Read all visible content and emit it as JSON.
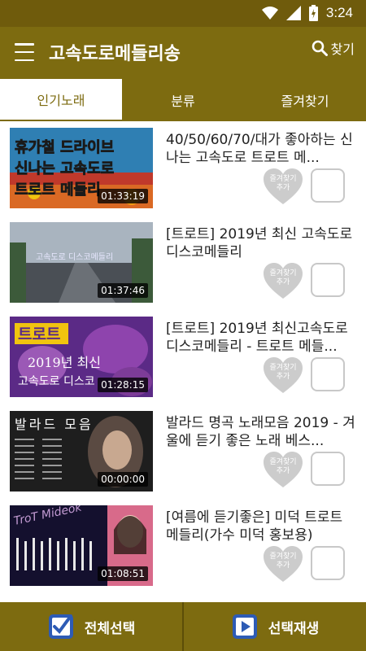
{
  "status_bar": {
    "time": "3:24",
    "icons": [
      "wifi-icon",
      "signal-icon",
      "battery-charging-icon"
    ]
  },
  "app_bar": {
    "title": "고속도로메들리송",
    "search_label": "찾기",
    "menu_icon": "hamburger-menu-icon",
    "search_icon": "search-icon"
  },
  "tabs": [
    {
      "label": "인기노래",
      "active": true
    },
    {
      "label": "분류",
      "active": false
    },
    {
      "label": "즐겨찾기",
      "active": false
    }
  ],
  "fav_label_line1": "즐겨찾기",
  "fav_label_line2": "추가",
  "items": [
    {
      "title": "40/50/60/70/대가 좋아하는 신나는 고속도로 트로트 메...",
      "duration": "01:33:19",
      "thumb_text": [
        "휴가철 드라이브",
        "신나는 고속도로",
        "트로트 메들리"
      ]
    },
    {
      "title": "[트로트] 2019년 최신 고속도로 디스코메들리",
      "duration": "01:37:46",
      "thumb_text": [
        "고속도로 디스코메들리"
      ]
    },
    {
      "title": "[트로트] 2019년 최신고속도로 디스코메들리 - 트로트 메들...",
      "duration": "01:28:15",
      "thumb_text": [
        "트로트",
        "2019년 최신",
        "고속도로 디스코"
      ]
    },
    {
      "title": "발라드 명곡 노래모음 2019 - 겨울에 듣기 좋은 노래 베스...",
      "duration": "00:00:00",
      "thumb_text": [
        "발라드 모음"
      ]
    },
    {
      "title": "[여름에 듣기좋은] 미덕 트로트 메들리(가수 미덕 홍보용)",
      "duration": "01:08:51",
      "thumb_text": [
        "TroT Mideok"
      ]
    }
  ],
  "bottom_bar": {
    "select_all_label": "전체선택",
    "play_selected_label": "선택재생"
  },
  "colors": {
    "primary": "#7d6b10",
    "status": "#6f5b0c",
    "heart": "#cccccc"
  }
}
